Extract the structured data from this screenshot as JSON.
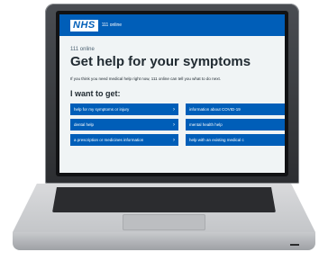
{
  "header": {
    "logo": "NHS",
    "service": "111 online"
  },
  "page": {
    "caption": "111 online",
    "title": "Get help for your symptoms",
    "intro": "If you think you need medical help right now, 111 online can tell you what to do next.",
    "want_heading": "I want to get:"
  },
  "options": [
    {
      "label": "help for my symptoms or injury",
      "chevron": "›"
    },
    {
      "label": "information about COVID-19",
      "chevron": "›"
    },
    {
      "label": "dental help",
      "chevron": "›"
    },
    {
      "label": "mental health help",
      "chevron": "›"
    },
    {
      "label": "a prescription or medicines information",
      "chevron": "›"
    },
    {
      "label": "help with an existing medical c",
      "chevron": ""
    }
  ],
  "colors": {
    "nhs_blue": "#005eb8",
    "page_bg": "#f0f4f5",
    "text": "#212b32"
  }
}
